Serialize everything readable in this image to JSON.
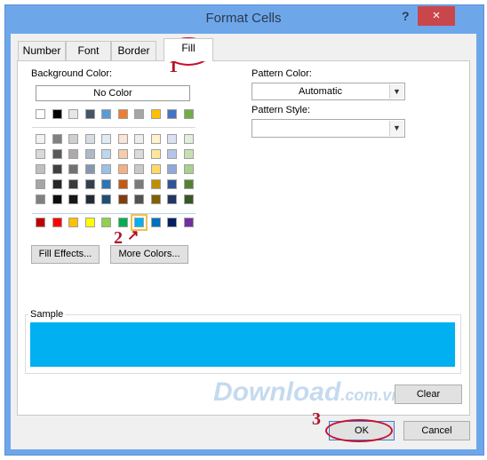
{
  "dialog": {
    "title": "Format Cells",
    "help": "?",
    "close": "×"
  },
  "tabs": [
    {
      "label": "Number"
    },
    {
      "label": "Font"
    },
    {
      "label": "Border"
    },
    {
      "label": "Fill",
      "active": true
    }
  ],
  "fill": {
    "background_label": "Background Color:",
    "no_color": "No Color",
    "theme_colors": [
      "#FFFFFF",
      "#000000",
      "#E7E6E6",
      "#44546A",
      "#5B9BD5",
      "#ED7D31",
      "#A5A5A5",
      "#FFC000",
      "#4472C4",
      "#70AD47"
    ],
    "tints": [
      [
        "#F2F2F2",
        "#808080",
        "#D0CECE",
        "#D6DCE4",
        "#DDEBF7",
        "#FCE4D6",
        "#EDEDED",
        "#FFF2CC",
        "#D9E1F2",
        "#E2EFDA"
      ],
      [
        "#D9D9D9",
        "#595959",
        "#AEAAAA",
        "#ADB9CA",
        "#BDD7EE",
        "#F8CBAD",
        "#DBDBDB",
        "#FFE699",
        "#B4C6E7",
        "#C6E0B4"
      ],
      [
        "#BFBFBF",
        "#404040",
        "#757171",
        "#8497B0",
        "#9BC2E6",
        "#F4B084",
        "#C9C9C9",
        "#FFD966",
        "#8EA9DB",
        "#A9D08E"
      ],
      [
        "#A6A6A6",
        "#262626",
        "#3A3838",
        "#333F4F",
        "#2F75B5",
        "#C65911",
        "#7B7B7B",
        "#BF8F00",
        "#305496",
        "#548235"
      ],
      [
        "#808080",
        "#0D0D0D",
        "#161616",
        "#222B35",
        "#1F4E78",
        "#833C0C",
        "#525252",
        "#806000",
        "#203764",
        "#375623"
      ]
    ],
    "standard_colors": [
      "#C00000",
      "#FF0000",
      "#FFC000",
      "#FFFF00",
      "#92D050",
      "#00B050",
      "#00B0F0",
      "#0070C0",
      "#002060",
      "#7030A0"
    ],
    "selected_color": "#00B0F0",
    "fill_effects": "Fill Effects...",
    "more_colors": "More Colors...",
    "pattern_color_label": "Pattern Color:",
    "pattern_color_value": "Automatic",
    "pattern_style_label": "Pattern Style:",
    "pattern_style_value": "",
    "sample_label": "Sample",
    "clear": "Clear"
  },
  "buttons": {
    "ok": "OK",
    "cancel": "Cancel"
  },
  "annotations": {
    "step1": "1",
    "step2": "2",
    "step3": "3"
  },
  "watermark": "Download.com.vn"
}
